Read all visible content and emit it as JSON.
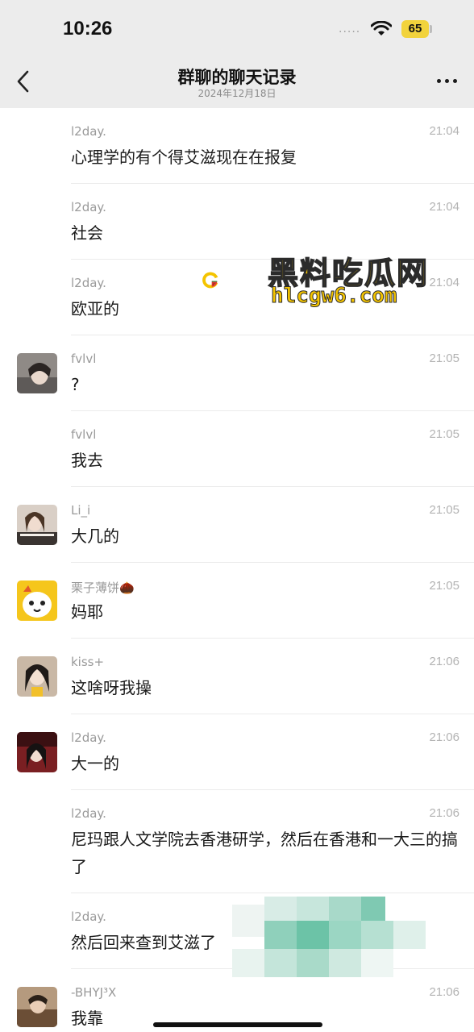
{
  "status_bar": {
    "time": "10:26",
    "signal": "·····",
    "battery": "65",
    "battery_color": "#f2d33c"
  },
  "nav": {
    "title": "群聊的聊天记录",
    "subtitle": "2024年12月18日",
    "back_icon": "chevron-left-icon",
    "more_icon": "more-horizontal-icon"
  },
  "watermark": {
    "line1": "黑料吃瓜网",
    "line2": "hlcgw6.com"
  },
  "messages": [
    {
      "sender": "l2day.",
      "time": "21:04",
      "text": "心理学的有个得艾滋现在在报复",
      "avatar": false
    },
    {
      "sender": "l2day.",
      "time": "21:04",
      "text": "社会",
      "avatar": false
    },
    {
      "sender": "l2day.",
      "time": "21:04",
      "text": "欧亚的",
      "avatar": false
    },
    {
      "sender": "fvlvl",
      "time": "21:05",
      "text": "?",
      "avatar": true
    },
    {
      "sender": "fvlvl",
      "time": "21:05",
      "text": "我去",
      "avatar": false
    },
    {
      "sender": "Li_i",
      "time": "21:05",
      "text": "大几的",
      "avatar": true
    },
    {
      "sender": "栗子薄饼🌰",
      "time": "21:05",
      "text": "妈耶",
      "avatar": true
    },
    {
      "sender": "kiss+",
      "time": "21:06",
      "text": "这啥呀我操",
      "avatar": true
    },
    {
      "sender": "l2day.",
      "time": "21:06",
      "text": "大一的",
      "avatar": true
    },
    {
      "sender": "l2day.",
      "time": "21:06",
      "text": "尼玛跟人文学院去香港研学，然后在香港和一大三的搞了",
      "avatar": false
    },
    {
      "sender": "l2day.",
      "time": "",
      "text": "然后回来查到艾滋了",
      "avatar": false
    },
    {
      "sender": "-BHYJ³X",
      "time": "21:06",
      "text": "我靠",
      "avatar": true
    }
  ]
}
